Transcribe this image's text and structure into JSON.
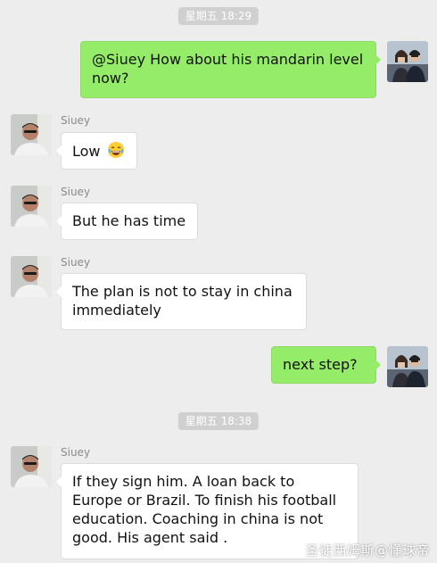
{
  "timestamps": [
    "星期五 18:29",
    "星期五 18:38"
  ],
  "messages": [
    {
      "from": "me",
      "text": "@Siuey How about his mandarin level now?"
    },
    {
      "from": "Siuey",
      "sender": "Siuey",
      "text": "Low",
      "emoji": "tears-of-joy-emoji"
    },
    {
      "from": "Siuey",
      "sender": "Siuey",
      "text": "But he has time"
    },
    {
      "from": "Siuey",
      "sender": "Siuey",
      "text": "The plan is not to stay in china immediately"
    },
    {
      "from": "me",
      "text": "next step?"
    },
    {
      "from": "Siuey",
      "sender": "Siuey",
      "text": "If they sign him. A loan back to Europe or Brazil. To finish his football education. Coaching in china is not good. His agent said ."
    }
  ],
  "watermark": "圣徒西姆斯@懂球帝",
  "colors": {
    "background": "#ededed",
    "outgoing_bubble": "#95ec69",
    "incoming_bubble": "#ffffff",
    "timestamp_bg": "#d0d0d0"
  }
}
